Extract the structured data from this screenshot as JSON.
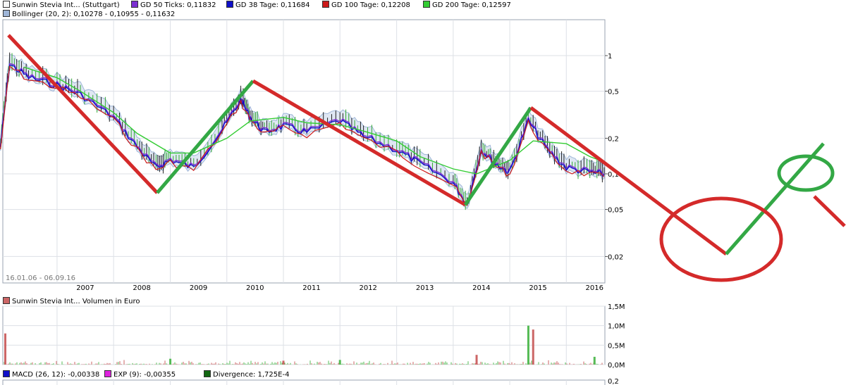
{
  "legend_price": [
    {
      "label": "Sunwin Stevia Int... (Stuttgart)",
      "color": "#f5f5f5"
    },
    {
      "label": "GD 50 Ticks: 0,11832",
      "color": "#7b2fd0"
    },
    {
      "label": "GD 38 Tage: 0,11684",
      "color": "#1010c8"
    },
    {
      "label": "GD 100 Tage: 0,12208",
      "color": "#cc1a1a"
    },
    {
      "label": "GD 200 Tage: 0,12597",
      "color": "#33cc33"
    },
    {
      "label": "Bollinger (20, 2): 0,10278 - 0,10955 - 0,11632",
      "color": "#9fb6d8"
    }
  ],
  "legend_volume": [
    {
      "label": "Sunwin Stevia Int... Volumen in Euro",
      "color": "#cc6666"
    }
  ],
  "legend_macd": [
    {
      "label": "MACD (26, 12): -0,00338",
      "color": "#1010c8"
    },
    {
      "label": "EXP (9): -0,00355",
      "color": "#dd22dd"
    },
    {
      "label": "Divergence: 1,725E-4",
      "color": "#116611"
    }
  ],
  "date_range": "16.01.06 - 06.09.16",
  "price_ticks": [
    "1",
    "0,5",
    "0,2",
    "0,1",
    "0,05",
    "0,02"
  ],
  "volume_ticks": [
    "1,5M",
    "1,0M",
    "0,5M",
    "0,0M"
  ],
  "macd_ticks": [
    "0,2"
  ],
  "year_labels": [
    "2007",
    "2008",
    "2009",
    "2010",
    "2011",
    "2012",
    "2013",
    "2014",
    "2015",
    "2016"
  ],
  "colors": {
    "gd50": "#7b2fd0",
    "gd38": "#1010c8",
    "gd100": "#cc1a1a",
    "gd200": "#33cc33",
    "bollinger": "#9fb6d8",
    "annotation_red": "#d42a2a",
    "annotation_green": "#33a845",
    "volume_red": "#cc6666",
    "volume_green": "#55bb55",
    "grid": "#dde0e6"
  },
  "chart_data": [
    {
      "type": "line",
      "scale": "log",
      "y_ticks": [
        1,
        0.5,
        0.2,
        0.1,
        0.05,
        0.02
      ],
      "x_range": [
        "2006-01-16",
        "2016-09-06"
      ],
      "series": [
        {
          "name": "Sunwin Stevia Int... (Stuttgart)",
          "x": [
            "2006-01",
            "2006-03",
            "2006-07",
            "2007-01",
            "2007-06",
            "2008-01",
            "2008-06",
            "2008-10",
            "2009-01",
            "2009-06",
            "2009-12",
            "2010-04",
            "2010-06",
            "2010-09",
            "2011-01",
            "2011-06",
            "2012-01",
            "2012-06",
            "2013-01",
            "2013-06",
            "2014-01",
            "2014-04",
            "2014-07",
            "2014-10",
            "2015-01",
            "2015-05",
            "2015-09",
            "2016-01",
            "2016-06",
            "2016-09"
          ],
          "y": [
            0.18,
            0.9,
            0.7,
            0.6,
            0.5,
            0.32,
            0.18,
            0.12,
            0.14,
            0.12,
            0.25,
            0.45,
            0.32,
            0.24,
            0.27,
            0.24,
            0.3,
            0.22,
            0.17,
            0.13,
            0.09,
            0.058,
            0.17,
            0.13,
            0.11,
            0.3,
            0.17,
            0.12,
            0.11,
            0.105
          ]
        },
        {
          "name": "GD 200 Tage: 0,12597",
          "x": [
            "2006-06",
            "2007-01",
            "2007-06",
            "2008-01",
            "2008-06",
            "2009-01",
            "2009-06",
            "2010-01",
            "2010-06",
            "2011-01",
            "2011-06",
            "2012-01",
            "2012-06",
            "2013-01",
            "2013-06",
            "2014-01",
            "2014-06",
            "2015-01",
            "2015-06",
            "2016-01",
            "2016-06",
            "2016-09"
          ],
          "y": [
            0.8,
            0.65,
            0.5,
            0.33,
            0.22,
            0.15,
            0.15,
            0.2,
            0.28,
            0.3,
            0.27,
            0.26,
            0.23,
            0.19,
            0.14,
            0.11,
            0.1,
            0.13,
            0.19,
            0.18,
            0.14,
            0.126
          ]
        }
      ]
    },
    {
      "type": "bar",
      "title": "Sunwin Stevia Int... Volumen in Euro",
      "ylim": [
        0,
        1.5
      ],
      "y_ticks": [
        "1,5M",
        "1,0M",
        "0,5M",
        "0,0M"
      ],
      "x": [
        "2006-02",
        "2009-01",
        "2011-01",
        "2012-01",
        "2014-06",
        "2015-05",
        "2015-06",
        "2016-07"
      ],
      "values": [
        0.8,
        0.15,
        0.1,
        0.12,
        0.25,
        1.0,
        0.9,
        0.2
      ]
    }
  ]
}
